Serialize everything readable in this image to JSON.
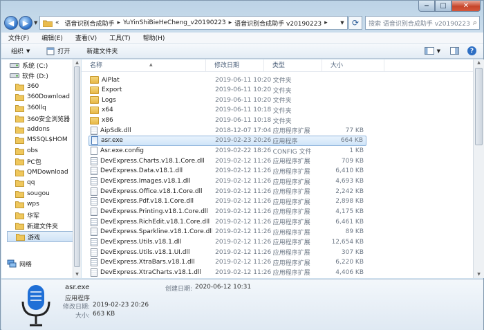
{
  "address": {
    "crumbs": [
      "«",
      "语音识别合成助手",
      "YuYinShiBieHeCheng_v20190223",
      "语音识别合成助手 v20190223"
    ]
  },
  "search": {
    "placeholder": "搜索 语音识别合成助手 v20190223"
  },
  "menu": [
    "文件(F)",
    "编辑(E)",
    "查看(V)",
    "工具(T)",
    "帮助(H)"
  ],
  "toolbar": {
    "organize": "组织",
    "open": "打开",
    "new_folder": "新建文件夹"
  },
  "nav": {
    "items": [
      {
        "label": "系统 (C:)",
        "kind": "drive"
      },
      {
        "label": "软件 (D:)",
        "kind": "drive"
      },
      {
        "label": "360",
        "kind": "folder"
      },
      {
        "label": "360Download",
        "kind": "folder"
      },
      {
        "label": "360llq",
        "kind": "folder"
      },
      {
        "label": "360安全浏览器",
        "kind": "folder"
      },
      {
        "label": "addons",
        "kind": "folder"
      },
      {
        "label": "MSSQL$HOM",
        "kind": "folder"
      },
      {
        "label": "obs",
        "kind": "folder"
      },
      {
        "label": "PC包",
        "kind": "folder"
      },
      {
        "label": "QMDownload",
        "kind": "folder"
      },
      {
        "label": "qq",
        "kind": "folder"
      },
      {
        "label": "sougou",
        "kind": "folder"
      },
      {
        "label": "wps",
        "kind": "folder"
      },
      {
        "label": "华军",
        "kind": "folder"
      },
      {
        "label": "新建文件夹",
        "kind": "folder"
      },
      {
        "label": "游戏",
        "kind": "folder"
      },
      {
        "label": "网络",
        "kind": "network"
      }
    ]
  },
  "columns": {
    "name": "名称",
    "date": "修改日期",
    "type": "类型",
    "size": "大小"
  },
  "files": [
    {
      "name": "AiPlat",
      "date": "2019-06-11 10:20",
      "type": "文件夹",
      "size": "",
      "kind": "folder"
    },
    {
      "name": "Export",
      "date": "2019-06-11 10:20",
      "type": "文件夹",
      "size": "",
      "kind": "folder"
    },
    {
      "name": "Logs",
      "date": "2019-06-11 10:20",
      "type": "文件夹",
      "size": "",
      "kind": "folder"
    },
    {
      "name": "x64",
      "date": "2019-06-11 10:18",
      "type": "文件夹",
      "size": "",
      "kind": "folder"
    },
    {
      "name": "x86",
      "date": "2019-06-11 10:18",
      "type": "文件夹",
      "size": "",
      "kind": "folder"
    },
    {
      "name": "AipSdk.dll",
      "date": "2018-12-07 17:04",
      "type": "应用程序扩展",
      "size": "77 KB",
      "kind": "dll"
    },
    {
      "name": "asr.exe",
      "date": "2019-02-23 20:26",
      "type": "应用程序",
      "size": "664 KB",
      "kind": "exe",
      "selected": true
    },
    {
      "name": "Asr.exe.config",
      "date": "2019-02-22 18:26",
      "type": "CONFIG 文件",
      "size": "1 KB",
      "kind": "file"
    },
    {
      "name": "DevExpress.Charts.v18.1.Core.dll",
      "date": "2019-02-12 11:26",
      "type": "应用程序扩展",
      "size": "709 KB",
      "kind": "dll"
    },
    {
      "name": "DevExpress.Data.v18.1.dll",
      "date": "2019-02-12 11:26",
      "type": "应用程序扩展",
      "size": "6,410 KB",
      "kind": "dll"
    },
    {
      "name": "DevExpress.Images.v18.1.dll",
      "date": "2019-02-12 11:26",
      "type": "应用程序扩展",
      "size": "4,693 KB",
      "kind": "dll"
    },
    {
      "name": "DevExpress.Office.v18.1.Core.dll",
      "date": "2019-02-12 11:26",
      "type": "应用程序扩展",
      "size": "2,242 KB",
      "kind": "dll"
    },
    {
      "name": "DevExpress.Pdf.v18.1.Core.dll",
      "date": "2019-02-12 11:26",
      "type": "应用程序扩展",
      "size": "2,898 KB",
      "kind": "dll"
    },
    {
      "name": "DevExpress.Printing.v18.1.Core.dll",
      "date": "2019-02-12 11:26",
      "type": "应用程序扩展",
      "size": "4,175 KB",
      "kind": "dll"
    },
    {
      "name": "DevExpress.RichEdit.v18.1.Core.dll",
      "date": "2019-02-12 11:26",
      "type": "应用程序扩展",
      "size": "6,461 KB",
      "kind": "dll"
    },
    {
      "name": "DevExpress.Sparkline.v18.1.Core.dll",
      "date": "2019-02-12 11:26",
      "type": "应用程序扩展",
      "size": "89 KB",
      "kind": "dll"
    },
    {
      "name": "DevExpress.Utils.v18.1.dll",
      "date": "2019-02-12 11:26",
      "type": "应用程序扩展",
      "size": "12,654 KB",
      "kind": "dll"
    },
    {
      "name": "DevExpress.Utils.v18.1.UI.dll",
      "date": "2019-02-12 11:26",
      "type": "应用程序扩展",
      "size": "307 KB",
      "kind": "dll"
    },
    {
      "name": "DevExpress.XtraBars.v18.1.dll",
      "date": "2019-02-12 11:26",
      "type": "应用程序扩展",
      "size": "6,220 KB",
      "kind": "dll"
    },
    {
      "name": "DevExpress.XtraCharts.v18.1.dll",
      "date": "2019-02-12 11:26",
      "type": "应用程序扩展",
      "size": "4,406 KB",
      "kind": "dll"
    }
  ],
  "details": {
    "name": "asr.exe",
    "type": "应用程序",
    "created_label": "创建日期:",
    "created": "2020-06-12 10:31",
    "modified_label": "修改日期:",
    "modified": "2019-02-23 20:26",
    "size_label": "大小:",
    "size": "663 KB"
  },
  "colors": {
    "accent": "#2a6fc7",
    "selection": "#cfe4f8",
    "mic": "#1f6fd6"
  }
}
